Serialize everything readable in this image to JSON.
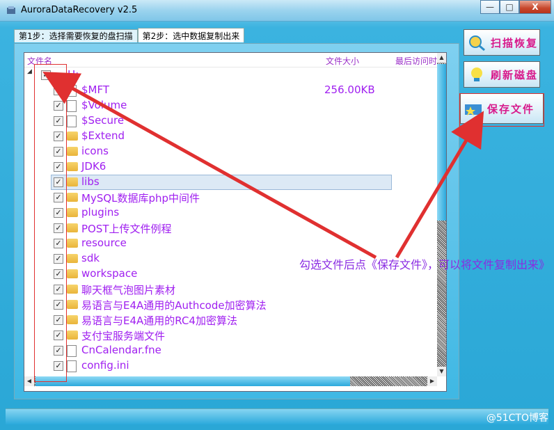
{
  "window": {
    "title": "AuroraDataRecovery v2.5",
    "min_label": "—",
    "max_label": "□",
    "close_label": "X"
  },
  "tabs": [
    {
      "label": "第1步：选择需要恢复的盘扫描"
    },
    {
      "label": "第2步：选中数据复制出来"
    }
  ],
  "columns": {
    "name": "文件名",
    "size": "文件大小",
    "access": "最后访问时"
  },
  "drive": {
    "label": "H:",
    "expander": "◢",
    "checked": "✓"
  },
  "rows": [
    {
      "name": "$MFT",
      "size": "256.00KB",
      "icon": "file-icon"
    },
    {
      "name": "$Volume",
      "icon": "file-icon"
    },
    {
      "name": "$Secure",
      "icon": "file-icon"
    },
    {
      "name": "$Extend",
      "icon": "folder-icon"
    },
    {
      "name": "icons",
      "icon": "folder-icon"
    },
    {
      "name": "JDK6",
      "icon": "folder-icon"
    },
    {
      "name": "libs",
      "icon": "folder-icon",
      "selected": true
    },
    {
      "name": "MySQL数据库php中间件",
      "icon": "folder-icon"
    },
    {
      "name": "plugins",
      "icon": "folder-icon"
    },
    {
      "name": "POST上传文件例程",
      "icon": "folder-icon"
    },
    {
      "name": "resource",
      "icon": "folder-icon"
    },
    {
      "name": "sdk",
      "icon": "folder-icon"
    },
    {
      "name": "workspace",
      "icon": "folder-icon"
    },
    {
      "name": "聊天框气泡图片素材",
      "icon": "folder-icon"
    },
    {
      "name": "易语言与E4A通用的Authcode加密算法",
      "icon": "folder-icon"
    },
    {
      "name": "易语言与E4A通用的RC4加密算法",
      "icon": "folder-icon"
    },
    {
      "name": "支付宝服务端文件",
      "icon": "folder-icon"
    },
    {
      "name": "CnCalendar.fne",
      "icon": "fne-file-icon"
    },
    {
      "name": "config.ini",
      "icon": "ini-file-icon"
    }
  ],
  "buttons": {
    "scan": "扫描恢复",
    "refresh": "刷新磁盘",
    "save": "保存文件"
  },
  "annotation": "勾选文件后点《保存文件》，可以将文件复制出来》",
  "watermark": "@51CTO博客",
  "colors": {
    "accent": "#a020f0",
    "button_text": "#d81b8c",
    "arrow": "#e03030"
  }
}
